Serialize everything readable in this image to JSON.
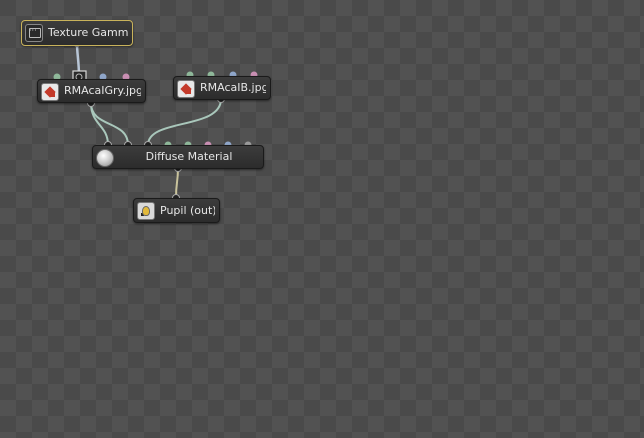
{
  "nodes": {
    "texture_gamma": {
      "label": "Texture Gamma",
      "icon": "monitor-icon"
    },
    "rmacalgry": {
      "label": "RMAcaIGry.jpg",
      "icon": "image-icon"
    },
    "rmacalb": {
      "label": "RMAcaIB.jpg",
      "icon": "image-icon"
    },
    "diffuse_material": {
      "label": "Diffuse Material",
      "icon": "sphere-icon"
    },
    "pupil_out": {
      "label": "Pupil (out)",
      "icon": "output-icon"
    }
  },
  "colors": {
    "background_light": "#525252",
    "background_dark": "#4a4a4a",
    "wire": "#a9c7bb",
    "wire_gamma": "#b8c6d6",
    "wire_output": "#c9c39c",
    "port_green": "#8fb89a",
    "port_blue": "#8fa6c9",
    "port_pink": "#c98fb3",
    "port_gray": "#9a9a9a",
    "selected_border": "#c9b35b"
  }
}
